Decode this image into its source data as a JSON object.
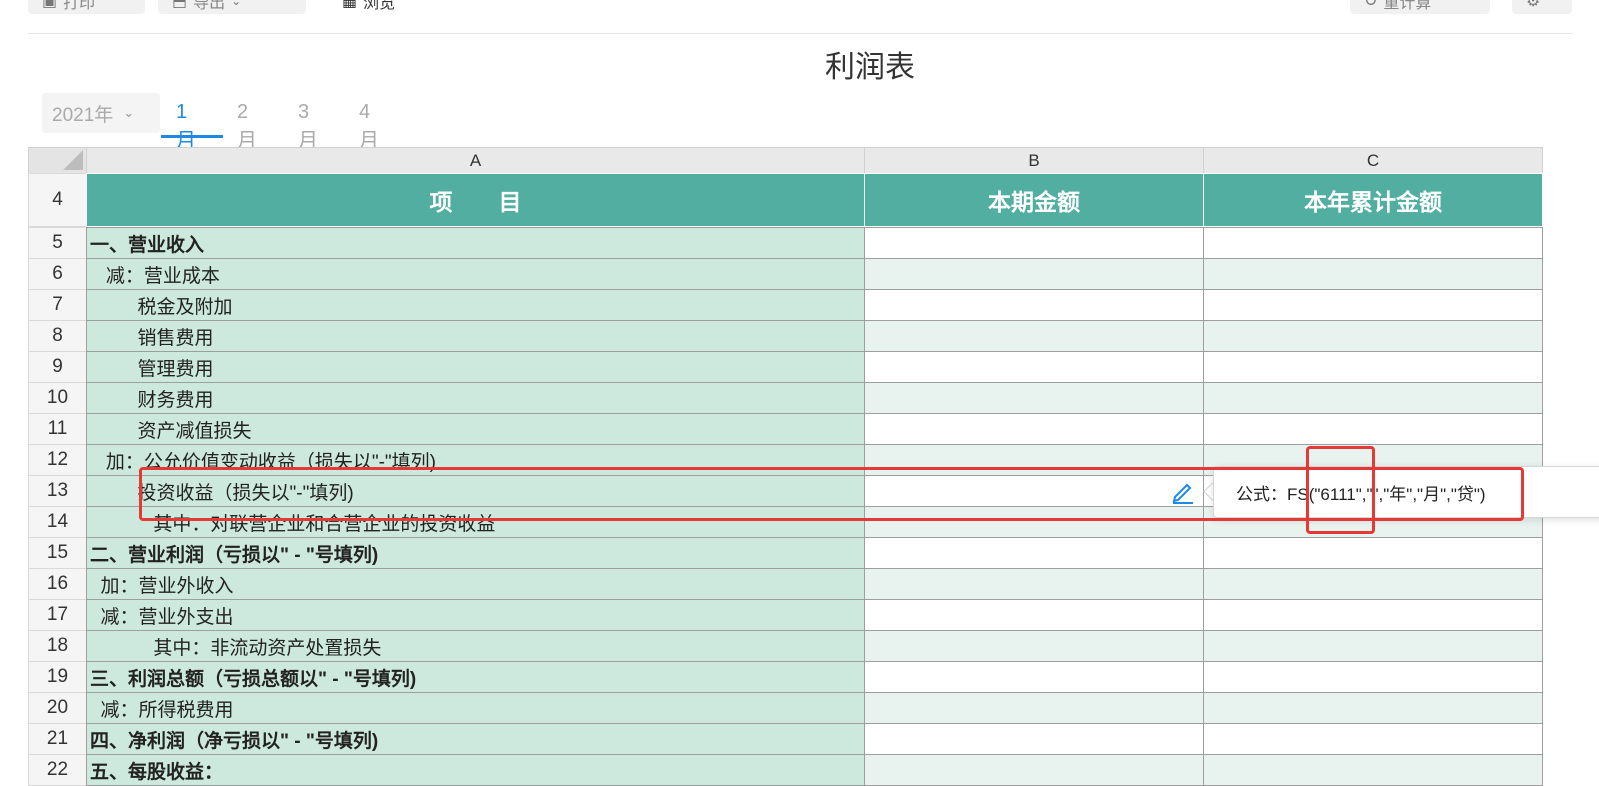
{
  "toolbar": {
    "print_label": "打印",
    "export_label": "导出",
    "preview_label": "浏览",
    "recalc_label": "重计算"
  },
  "title": "利润表",
  "period": {
    "year": "2021年",
    "months": [
      "1月",
      "2月",
      "3月",
      "4月"
    ],
    "active_month": "1月"
  },
  "sheet": {
    "columns": [
      "A",
      "B",
      "C"
    ],
    "header_row": {
      "number": "4",
      "a": "项　　目",
      "b": "本期金额",
      "c": "本年累计金额"
    },
    "rows": [
      {
        "number": "5",
        "label": "一、营业收入",
        "bold": true
      },
      {
        "number": "6",
        "label": "   减：营业成本",
        "bold": false
      },
      {
        "number": "7",
        "label": "         税金及附加",
        "bold": false
      },
      {
        "number": "8",
        "label": "         销售费用",
        "bold": false
      },
      {
        "number": "9",
        "label": "         管理费用",
        "bold": false
      },
      {
        "number": "10",
        "label": "         财务费用",
        "bold": false
      },
      {
        "number": "11",
        "label": "         资产减值损失",
        "bold": false
      },
      {
        "number": "12",
        "label": "   加：公允价值变动收益（损失以\"-\"填列)",
        "bold": false
      },
      {
        "number": "13",
        "label": "         投资收益（损失以\"-\"填列)",
        "bold": false
      },
      {
        "number": "14",
        "label": "            其中：对联营企业和合营企业的投资收益",
        "bold": false
      },
      {
        "number": "15",
        "label": "二、营业利润（亏损以\" - \"号填列)",
        "bold": true
      },
      {
        "number": "16",
        "label": "  加：营业外收入",
        "bold": false
      },
      {
        "number": "17",
        "label": "  减：营业外支出",
        "bold": false
      },
      {
        "number": "18",
        "label": "            其中：非流动资产处置损失",
        "bold": false
      },
      {
        "number": "19",
        "label": "三、利润总额（亏损总额以\" - \"号填列)",
        "bold": true
      },
      {
        "number": "20",
        "label": "  减：所得税费用",
        "bold": false
      },
      {
        "number": "21",
        "label": "四、净利润（净亏损以\" - \"号填列)",
        "bold": true
      },
      {
        "number": "22",
        "label": "五、每股收益：",
        "bold": true
      }
    ]
  },
  "formula_tooltip": {
    "text": "公式：FS(\"6111\",\"\",\"年\",\"月\",\"贷\")"
  },
  "colors": {
    "header_teal": "#52aea1",
    "label_column": "#cde9dd",
    "alt_row": "#e8f2ef",
    "accent_blue": "#1e88e5",
    "highlight_red": "#e53935"
  },
  "icons": [
    "print-icon",
    "export-icon",
    "preview-icon",
    "recalc-icon",
    "settings-icon",
    "edit-pencil-icon",
    "chevron-down-icon"
  ]
}
